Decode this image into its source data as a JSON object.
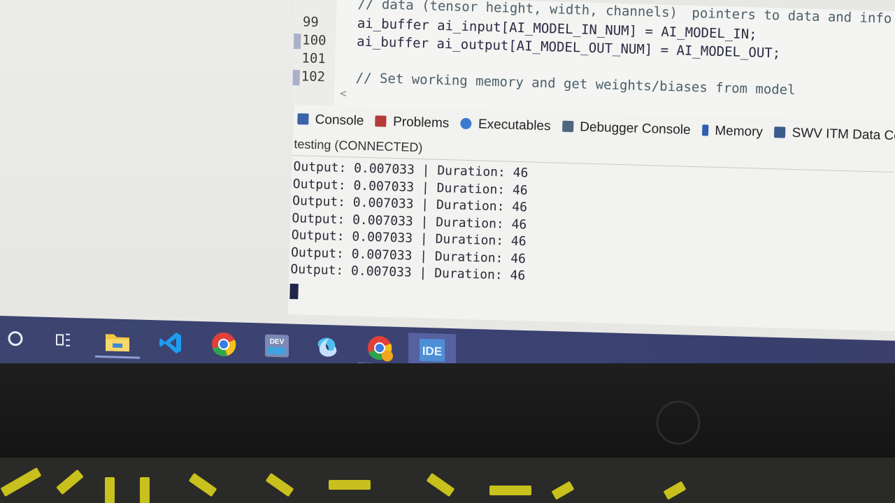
{
  "editor": {
    "lines": [
      {
        "number": "99",
        "code": "// data (tensor height, width, channels)",
        "comment": true,
        "trailing": "pointers to data and info ab"
      },
      {
        "number": "99",
        "code": "ai_buffer ai_input[AI_MODEL_IN_NUM] = AI_MODEL_IN;",
        "comment": false
      },
      {
        "number": "100",
        "code": "ai_buffer ai_output[AI_MODEL_OUT_NUM] = AI_MODEL_OUT;",
        "comment": false
      },
      {
        "number": "101",
        "code": "",
        "comment": false
      },
      {
        "number": "102",
        "code": "// Set working memory and get weights/biases from model",
        "comment": true
      }
    ],
    "scroll_left_glyph": "<"
  },
  "views": {
    "tabs": [
      {
        "label": "Console",
        "icon": "console-icon",
        "color": "#3a63a8"
      },
      {
        "label": "Problems",
        "icon": "problems-icon",
        "color": "#b53a3a"
      },
      {
        "label": "Executables",
        "icon": "executables-icon",
        "color": "#3a7bd0"
      },
      {
        "label": "Debugger Console",
        "icon": "debugger-console-icon",
        "color": "#4f6680"
      },
      {
        "label": "Memory",
        "icon": "memory-icon",
        "color": "#2f5fb0"
      },
      {
        "label": "SWV ITM Data Console",
        "icon": "swv-console-icon",
        "color": "#3b5c8a"
      }
    ],
    "status": "testing (CONNECTED)",
    "output": [
      "Output: 0.007033 | Duration: 46",
      "Output: 0.007033 | Duration: 46",
      "Output: 0.007033 | Duration: 46",
      "Output: 0.007033 | Duration: 46",
      "Output: 0.007033 | Duration: 46",
      "Output: 0.007033 | Duration: 46",
      "Output: 0.007033 | Duration: 46"
    ]
  },
  "taskbar": {
    "items": [
      {
        "name": "start-search-icon"
      },
      {
        "name": "task-view-icon"
      },
      {
        "name": "file-explorer-icon"
      },
      {
        "name": "vscode-icon"
      },
      {
        "name": "chrome-icon"
      },
      {
        "name": "devcpp-icon",
        "label": "DEV C++"
      },
      {
        "name": "copilot-icon"
      },
      {
        "name": "chrome-profile-icon"
      },
      {
        "name": "stm32cubeide-icon",
        "label": "IDE"
      }
    ]
  }
}
